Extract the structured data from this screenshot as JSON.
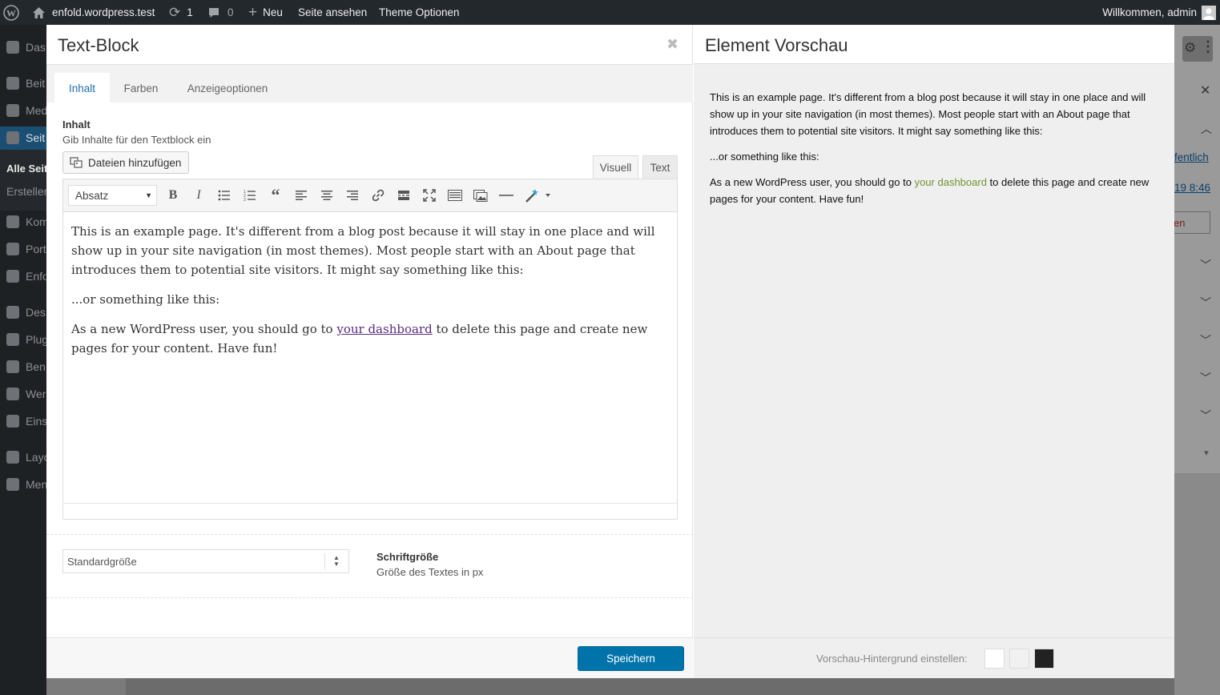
{
  "adminbar": {
    "site_name": "enfold.wordpress.test",
    "updates_count": "1",
    "comments_count": "0",
    "new_label": "Neu",
    "view_page": "Seite ansehen",
    "theme_options": "Theme Optionen",
    "greeting": "Willkommen, admin"
  },
  "sidebar": {
    "items": [
      {
        "label": "Das",
        "icon": "dashboard-icon"
      },
      {
        "label": "Beit",
        "icon": "pin-icon"
      },
      {
        "label": "Med",
        "icon": "media-icon"
      },
      {
        "label": "Seit",
        "icon": "pages-icon"
      },
      {
        "label": "Alle Seit"
      },
      {
        "label": "Erstellen"
      },
      {
        "label": "Kom",
        "icon": "comments-icon"
      },
      {
        "label": "Port",
        "icon": "portfolio-icon"
      },
      {
        "label": "Enfo",
        "icon": "enfold-icon"
      },
      {
        "label": "Des",
        "icon": "appearance-icon"
      },
      {
        "label": "Plug",
        "icon": "plugins-icon"
      },
      {
        "label": "Ben",
        "icon": "users-icon"
      },
      {
        "label": "Wer",
        "icon": "tools-icon"
      },
      {
        "label": "Eins",
        "icon": "settings-icon"
      },
      {
        "label": "Layo",
        "icon": "layout-icon"
      },
      {
        "label": "Men",
        "icon": "collapse-icon"
      }
    ]
  },
  "background_right": {
    "link_publish": "fentlich",
    "link_date": "19 8:46",
    "link_trash": "en"
  },
  "modal": {
    "title": "Text-Block",
    "tabs": [
      {
        "label": "Inhalt"
      },
      {
        "label": "Farben"
      },
      {
        "label": "Anzeigeoptionen"
      }
    ],
    "content_label": "Inhalt",
    "content_desc": "Gib Inhalte für den Textblock ein",
    "add_files": "Dateien hinzufügen",
    "editor_tab_visual": "Visuell",
    "editor_tab_text": "Text",
    "format_select": "Absatz",
    "editor": {
      "p1": "This is an example page. It's different from a blog post because it will stay in one place and will show up in your site navigation (in most themes). Most people start with an About page that introduces them to potential site visitors. It might say something like this:",
      "p2": "...or something like this:",
      "p3_before": "As a new WordPress user, you should go to ",
      "p3_link": "your dashboard",
      "p3_after": " to delete this page and create new pages for your content. Have fun!"
    },
    "font_size_select": "Standardgröße",
    "font_size_label": "Schriftgröße",
    "font_size_desc": "Größe des Textes in px",
    "save_button": "Speichern"
  },
  "preview": {
    "title": "Element Vorschau",
    "p1": "This is an example page. It's different from a blog post because it will stay in one place and will show up in your site navigation (in most themes). Most people start with an About page that introduces them to potential site visitors. It might say something like this:",
    "p2": "...or something like this:",
    "p3_before": "As a new WordPress user, you should go to ",
    "p3_link": "your dashboard",
    "p3_after": " to delete this page and create new pages for your content. Have fun!",
    "bg_label": "Vorschau-Hintergrund einstellen:",
    "swatches": [
      "#ffffff",
      "#f1f1f1",
      "#222222"
    ]
  },
  "colors": {
    "accent": "#0073aa",
    "adminbar_bg": "#23282d",
    "preview_link": "#719430",
    "editor_link": "#5a2c82"
  }
}
